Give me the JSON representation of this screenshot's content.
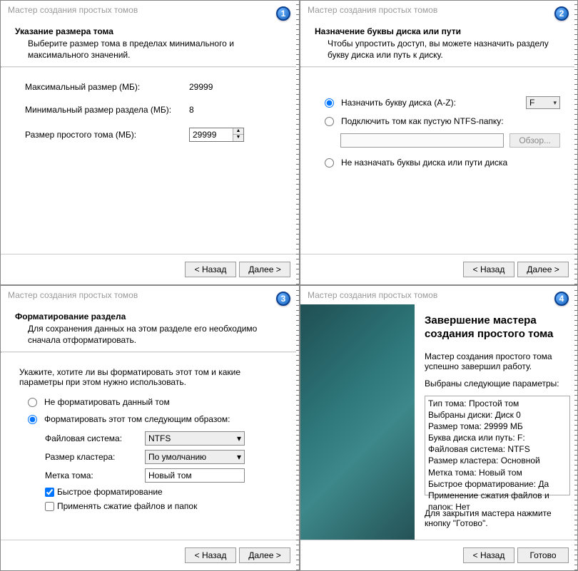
{
  "common": {
    "title": "Мастер создания простых томов",
    "back": "< Назад",
    "next": "Далее >",
    "finish": "Готово"
  },
  "p1": {
    "badge": "1",
    "heading": "Указание размера тома",
    "desc": "Выберите размер тома в пределах минимального и максимального значений.",
    "max_label": "Максимальный размер (МБ):",
    "max_val": "29999",
    "min_label": "Минимальный размер раздела (МБ):",
    "min_val": "8",
    "size_label": "Размер простого тома (МБ):",
    "size_val": "29999"
  },
  "p2": {
    "badge": "2",
    "heading": "Назначение буквы диска или пути",
    "desc": "Чтобы упростить доступ, вы можете назначить разделу букву диска или путь к диску.",
    "opt_assign": "Назначить букву диска (A-Z):",
    "letter": "F",
    "opt_mount": "Подключить том как пустую NTFS-папку:",
    "browse": "Обзор...",
    "opt_none": "Не назначать буквы диска или пути диска"
  },
  "p3": {
    "badge": "3",
    "heading": "Форматирование раздела",
    "desc": "Для сохранения данных на этом разделе его необходимо сначала отформатировать.",
    "intro": "Укажите, хотите ли вы форматировать этот том и какие параметры при этом нужно использовать.",
    "opt_no": "Не форматировать данный том",
    "opt_yes": "Форматировать этот том следующим образом:",
    "fs_label": "Файловая система:",
    "fs_val": "NTFS",
    "cluster_label": "Размер кластера:",
    "cluster_val": "По умолчанию",
    "vollabel_label": "Метка тома:",
    "vollabel_val": "Новый том",
    "quick": "Быстрое форматирование",
    "compress": "Применять сжатие файлов и папок"
  },
  "p4": {
    "badge": "4",
    "heading": "Завершение мастера создания простого тома",
    "done": "Мастер создания простого тома успешно завершил работу.",
    "selected": "Выбраны следующие параметры:",
    "lines": {
      "l0": "Тип тома: Простой том",
      "l1": "Выбраны диски: Диск 0",
      "l2": "Размер тома: 29999 МБ",
      "l3": "Буква диска или путь: F:",
      "l4": "Файловая система: NTFS",
      "l5": "Размер кластера: Основной",
      "l6": "Метка тома: Новый том",
      "l7": "Быстрое форматирование: Да",
      "l8": "Применение сжатия файлов и папок: Нет"
    },
    "close_text": "Для закрытия мастера нажмите кнопку \"Готово\"."
  }
}
